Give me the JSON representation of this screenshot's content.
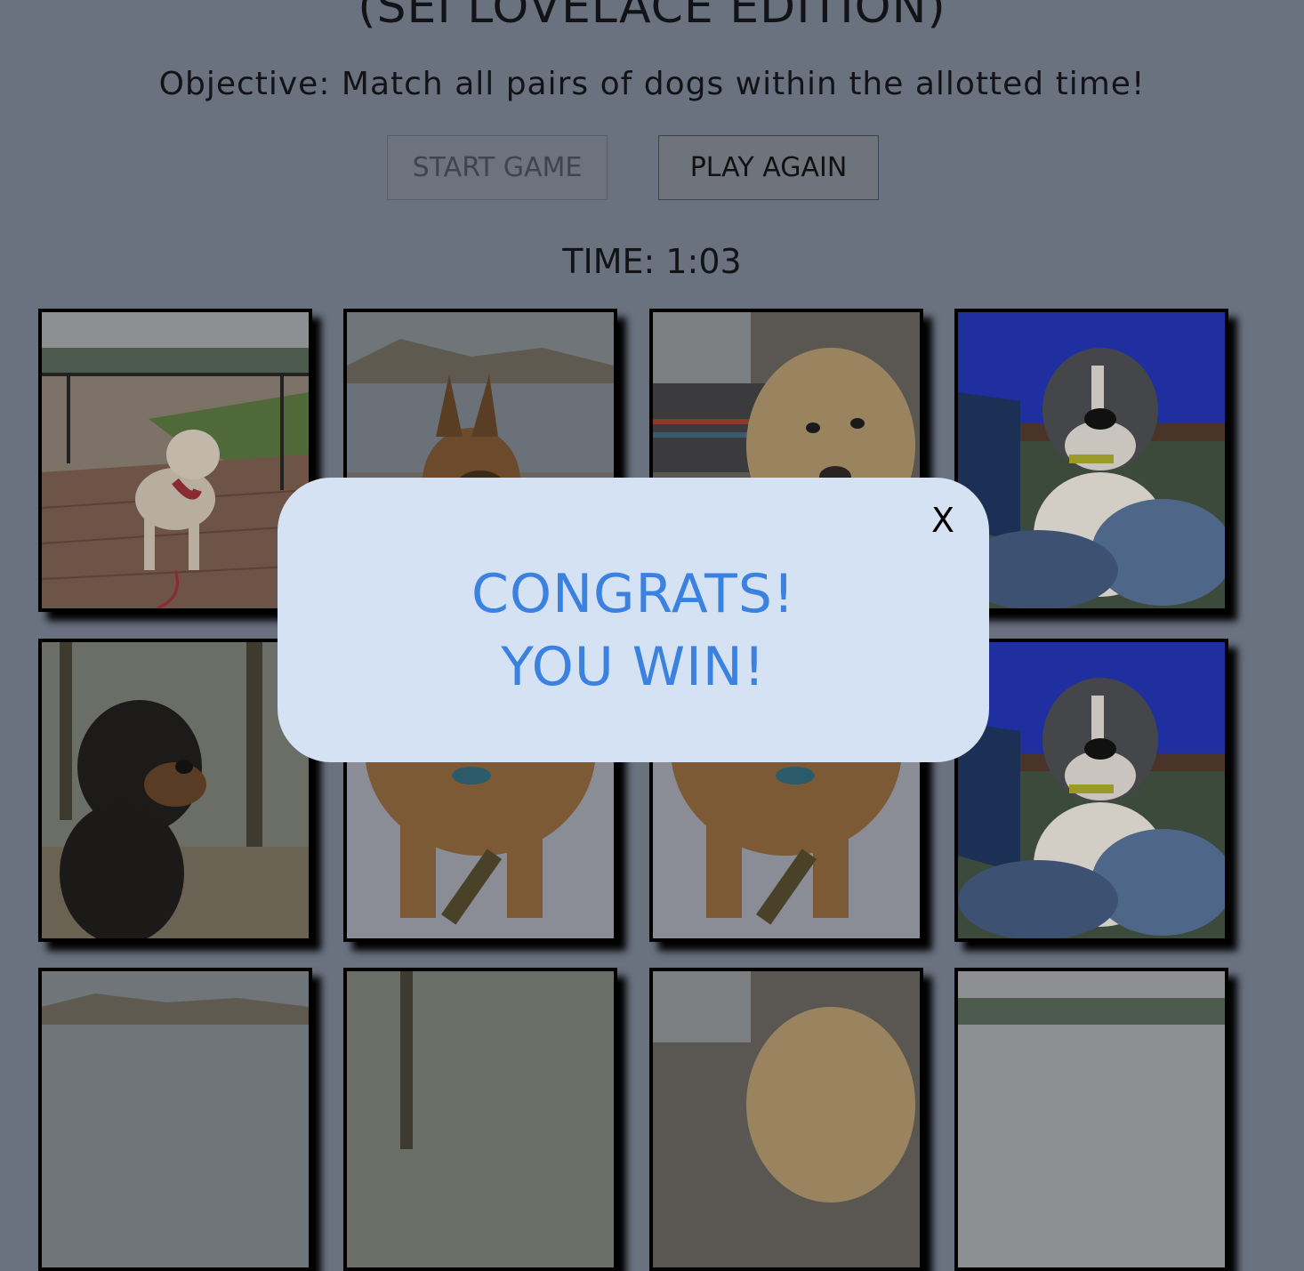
{
  "header": {
    "title": "(SEI LOVELACE EDITION)",
    "objective": "Objective: Match all pairs of dogs within the allotted time!"
  },
  "controls": {
    "start_label": "START GAME",
    "play_again_label": "PLAY AGAIN"
  },
  "timer": {
    "text": "TIME: 1:03"
  },
  "cards": [
    {
      "dog": "yellow-lab-on-deck"
    },
    {
      "dog": "german-shepherd-at-beach"
    },
    {
      "dog": "scruffy-terrier-mix"
    },
    {
      "dog": "grey-pitbull"
    },
    {
      "dog": "rottweiler-in-forest"
    },
    {
      "dog": "brown-dog-with-chew"
    },
    {
      "dog": "brown-dog-with-chew"
    },
    {
      "dog": "grey-pitbull"
    },
    {
      "dog": "german-shepherd-at-beach"
    },
    {
      "dog": "rottweiler-in-forest"
    },
    {
      "dog": "scruffy-terrier-mix"
    },
    {
      "dog": "yellow-lab-on-deck"
    }
  ],
  "modal": {
    "close_label": "X",
    "line1": "CONGRATS!",
    "line2": "YOU WIN!"
  },
  "colors": {
    "background": "#6a717f",
    "modal_bg": "#d5e2f3",
    "modal_text": "#3b82e0"
  }
}
